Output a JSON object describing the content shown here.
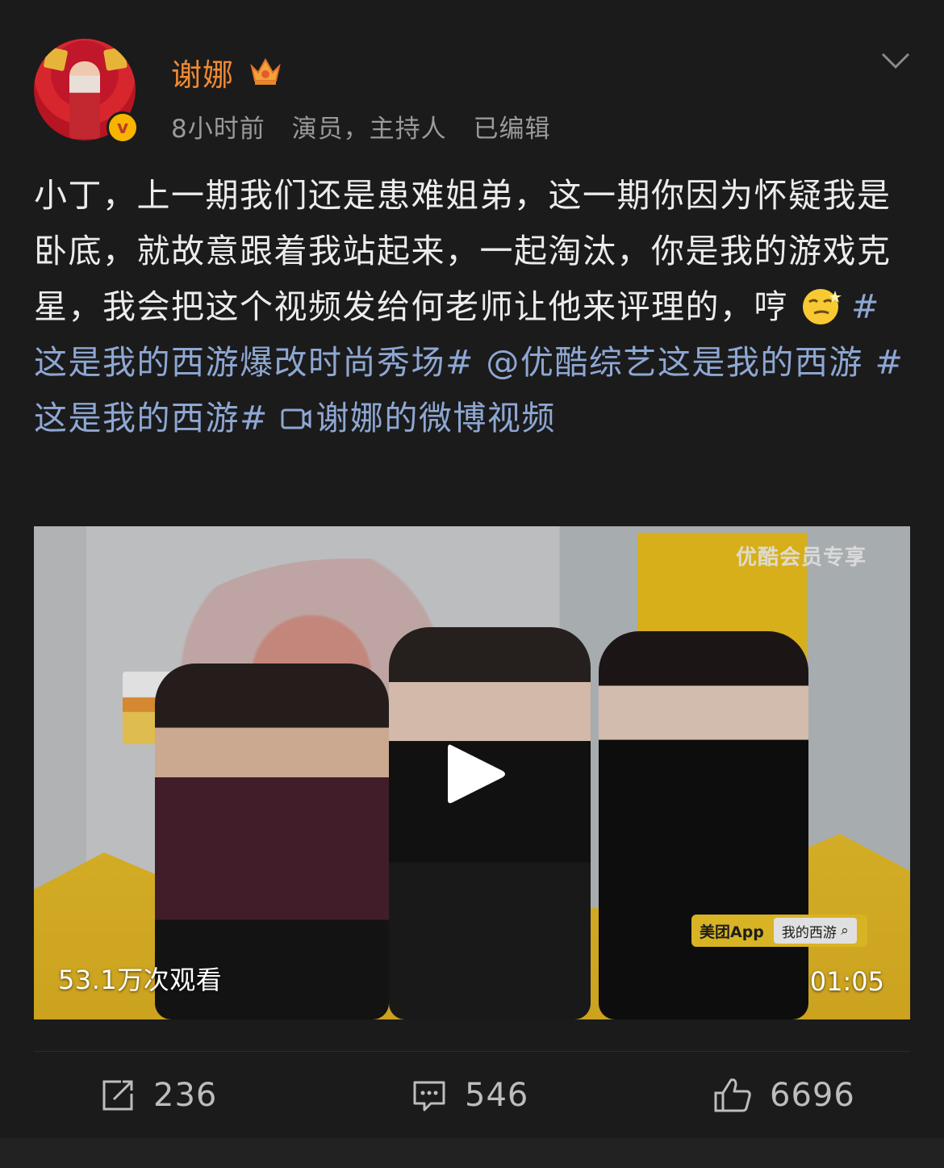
{
  "author": {
    "name": "谢娜",
    "time": "8小时前",
    "description": "演员，主持人",
    "edited": "已编辑"
  },
  "post": {
    "text_main": "小丁，上一期我们还是患难姐弟，这一期你因为怀疑我是卧底，就故意跟着我站起来，一起淘汰，你是我的游戏克星，我会把这个视频发给何老师让他来评理的，哼",
    "topic_1": "#这是我的西游爆改时尚秀场#",
    "mention": "@优酷综艺这是我的西游",
    "topic_2": "#这是我的西游#",
    "video_link": "谢娜的微博视频"
  },
  "video": {
    "views": "53.1万次观看",
    "duration": "01:05",
    "overlay_watermark": "优酷会员专享",
    "sponsor_app": "美团App",
    "sponsor_search": "我的西游"
  },
  "actions": {
    "repost_count": "236",
    "comment_count": "546",
    "like_count": "6696"
  },
  "colors": {
    "background": "#1b1b1b",
    "username": "#f08a33",
    "link": "#8ea7d3",
    "meta": "#9a9a9a"
  },
  "icons": [
    "avatar",
    "verified-badge-icon",
    "crown-icon",
    "chevron-down-icon",
    "smirk-emoji-icon",
    "video-link-icon",
    "play-icon",
    "repost-icon",
    "comment-icon",
    "like-icon"
  ]
}
